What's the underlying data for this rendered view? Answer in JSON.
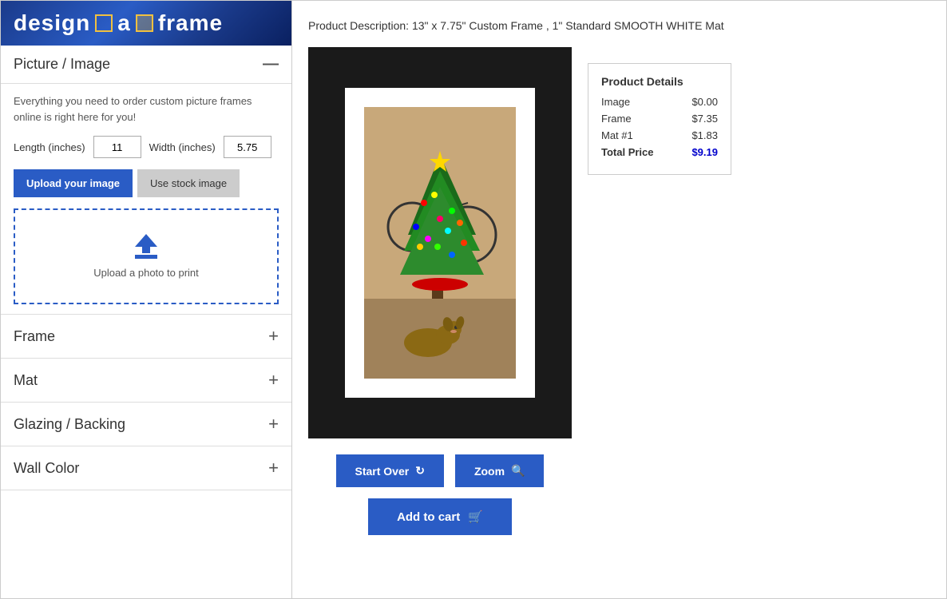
{
  "logo": {
    "text_before": "design",
    "text_after": "frame",
    "connector": "a"
  },
  "sidebar": {
    "picture_section": {
      "title": "Picture / Image",
      "collapse_icon": "—",
      "description": "Everything you need to order custom picture frames online is right here for you!",
      "length_label": "Length (inches)",
      "length_value": "11",
      "width_label": "Width (inches)",
      "width_value": "5.75",
      "upload_button_label": "Upload your image",
      "stock_button_label": "Use stock image",
      "drop_zone_label": "Upload a photo to print"
    },
    "frame_section": {
      "title": "Frame",
      "plus": "+"
    },
    "mat_section": {
      "title": "Mat",
      "plus": "+"
    },
    "glazing_section": {
      "title": "Glazing / Backing",
      "plus": "+"
    },
    "wall_color_section": {
      "title": "Wall Color",
      "plus": "+"
    }
  },
  "main": {
    "product_description_label": "Product Description:",
    "product_description": "13\" x 7.75\" Custom Frame , 1\" Standard SMOOTH WHITE Mat",
    "product_details": {
      "title": "Product Details",
      "rows": [
        {
          "label": "Image",
          "value": "$0.00"
        },
        {
          "label": "Frame",
          "value": "$7.35"
        },
        {
          "label": "Mat #1",
          "value": "$1.83"
        }
      ],
      "total_label": "Total Price",
      "total_value": "$9.19"
    },
    "start_over_button": "Start Over",
    "zoom_button": "Zoom",
    "add_to_cart_button": "Add to cart",
    "refresh_icon": "↻",
    "zoom_icon": "🔍",
    "cart_icon": "🛒"
  },
  "colors": {
    "brand_blue": "#2a5cc5",
    "total_price_color": "#0000cc"
  }
}
